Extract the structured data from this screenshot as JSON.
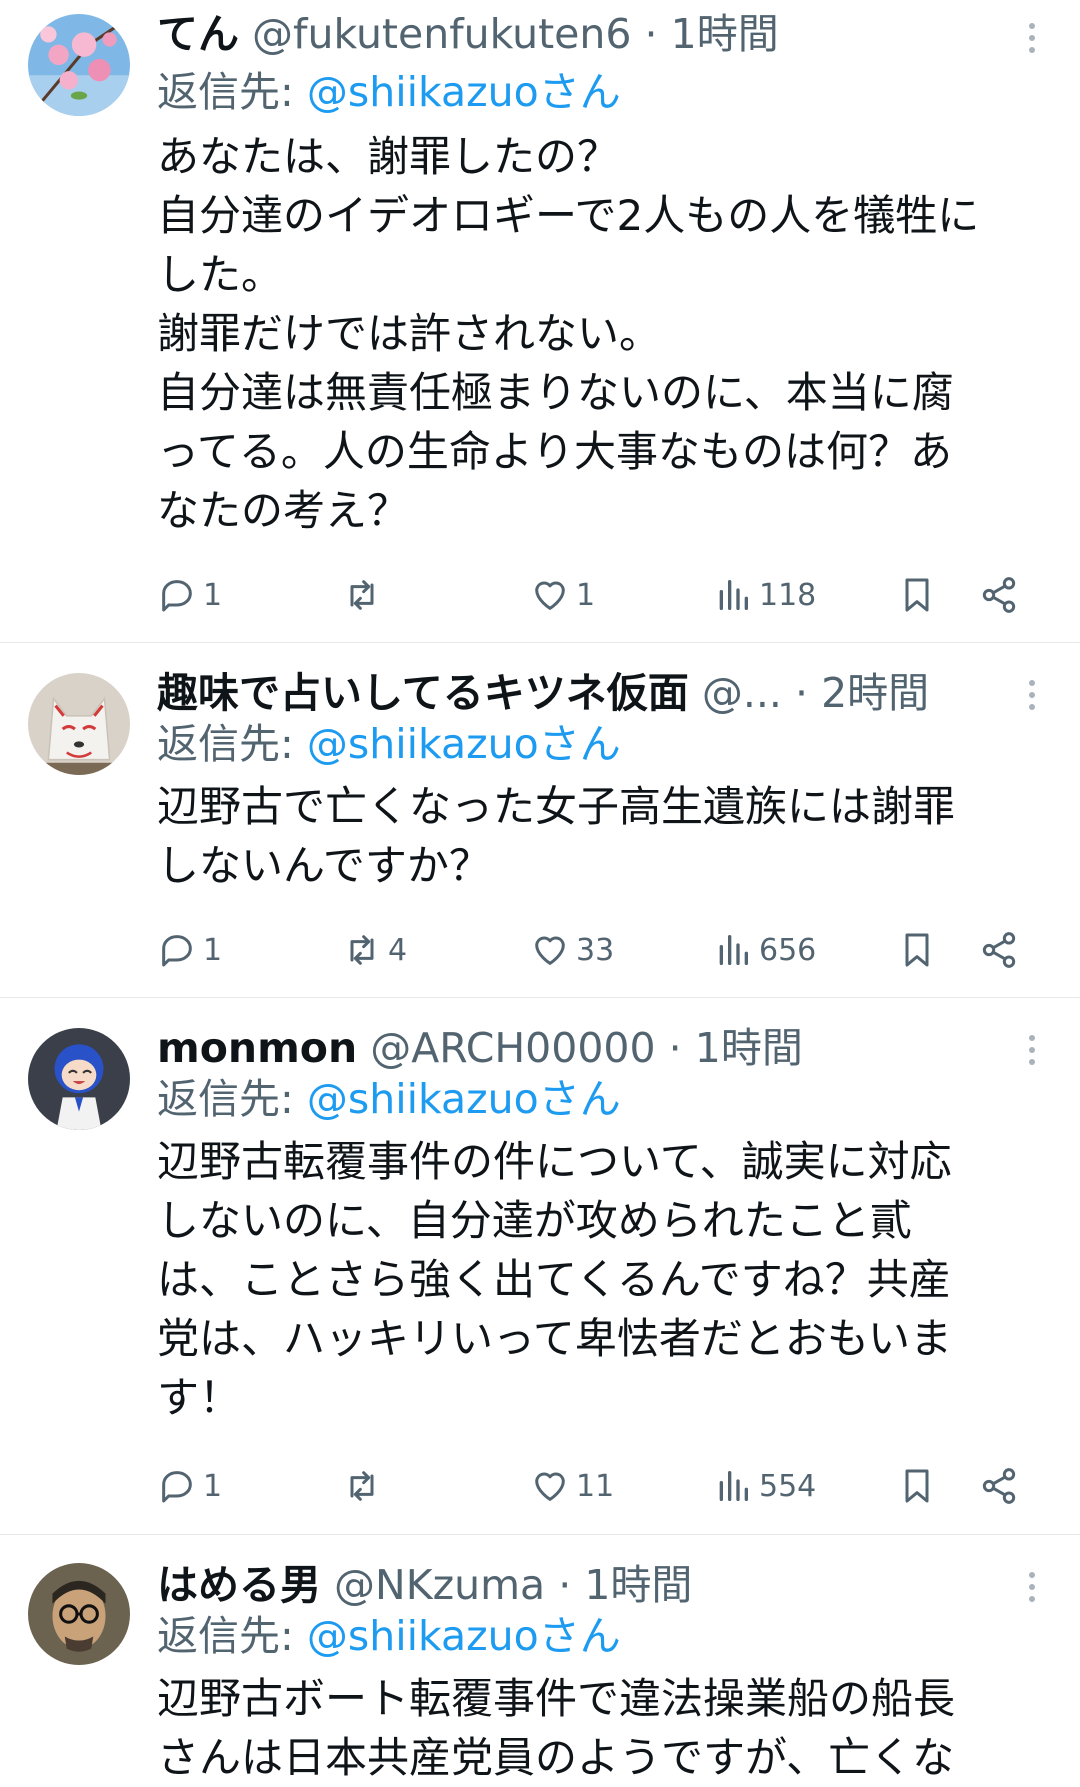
{
  "tweets": [
    {
      "name": "てん",
      "handle": "@fukutenfukuten6",
      "dot": "·",
      "time": "1時間",
      "reply_prefix": "返信先:",
      "reply_mention": "@shiikazuoさん",
      "text": "あなたは、謝罪したの？\n自分達のイデオロギーで2人もの人を犠牲に\nした。\n謝罪だけでは許されない。\n自分達は無責任極まりないのに、本当に腐\nってる。人の生命より大事なものは何？あ\nなたの考え？",
      "replies": "1",
      "retweets": "",
      "likes": "1",
      "views": "118",
      "avatar": "pink-blossom-avatar"
    },
    {
      "name": "趣味で占いしてるキツネ仮面",
      "handle": "@...",
      "dot": "·",
      "time": "2時間",
      "reply_prefix": "返信先:",
      "reply_mention": "@shiikazuoさん",
      "text": "辺野古で亡くなった女子高生遺族には謝罪\nしないんですか？",
      "replies": "1",
      "retweets": "4",
      "likes": "33",
      "views": "656",
      "avatar": "fox-mask-avatar"
    },
    {
      "name": "monmon",
      "handle": "@ARCH00000",
      "dot": "·",
      "time": "1時間",
      "reply_prefix": "返信先:",
      "reply_mention": "@shiikazuoさん",
      "text": "辺野古転覆事件の件について、誠実に対応\nしないのに、自分達が攻められたこと貳\nは、ことさら強く出てくるんですね？共産\n党は、ハッキリいって卑怯者だとおもいま\nす！",
      "replies": "1",
      "retweets": "",
      "likes": "11",
      "views": "554",
      "avatar": "blue-hair-figure-avatar"
    },
    {
      "name": "はめる男",
      "handle": "@NKzuma",
      "dot": "·",
      "time": "1時間",
      "reply_prefix": "返信先:",
      "reply_mention": "@shiikazuoさん",
      "text": "辺野古ボート転覆事件で違法操業船の船長\nさんは日本共産党員のようですが、亡くな",
      "avatar": "glasses-man-avatar"
    }
  ],
  "colors": {
    "text": "#0f1419",
    "secondary": "#536471",
    "link": "#1d9bf0",
    "divider": "#e6e9ec"
  },
  "icons": {
    "reply": "speech-bubble-icon",
    "retweet": "retweet-arrows-icon",
    "like": "heart-icon",
    "views": "bar-chart-icon",
    "bookmark": "bookmark-icon",
    "share": "share-icon",
    "more": "more-dots-icon"
  }
}
